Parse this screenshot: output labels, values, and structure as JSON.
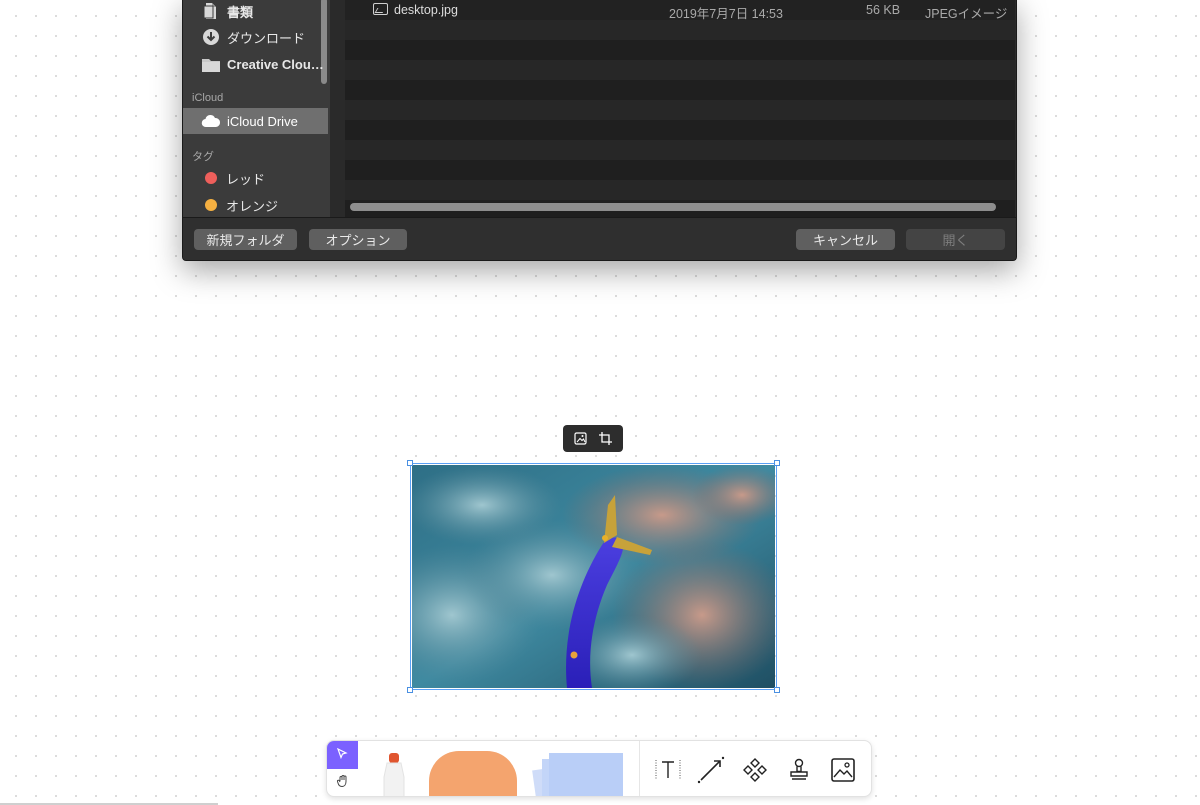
{
  "dialog": {
    "sidebar": {
      "favorites": [
        {
          "label": "書類",
          "icon": "document-icon"
        },
        {
          "label": "ダウンロード",
          "icon": "download-icon"
        },
        {
          "label": "Creative Clou…",
          "icon": "folder-icon"
        }
      ],
      "icloud_header": "iCloud",
      "icloud_items": [
        {
          "label": "iCloud Drive",
          "icon": "cloud-icon",
          "selected": true
        }
      ],
      "tags_header": "タグ",
      "tags": [
        {
          "label": "レッド",
          "color": "#ee5f5b"
        },
        {
          "label": "オレンジ",
          "color": "#f5b041"
        }
      ]
    },
    "files": [
      {
        "name": "desktop.jpg",
        "date": "2019年7月7日 14:53",
        "size": "56 KB",
        "kind": "JPEGイメージ"
      }
    ],
    "footer": {
      "new_folder": "新規フォルダ",
      "options": "オプション",
      "cancel": "キャンセル",
      "open": "開く"
    }
  },
  "canvas": {
    "image_toolbar": {
      "icons": [
        "image-icon",
        "crop-icon"
      ]
    },
    "selected_image": {
      "subject": "fish-photo",
      "selection_color": "#5aa0f5"
    }
  },
  "toolbar": {
    "accent": "#7b61ff",
    "tools": [
      "select",
      "hand",
      "marker",
      "shape",
      "sticky-note",
      "text",
      "connector",
      "component",
      "stamp",
      "image"
    ],
    "shape_color": "#f4a46e",
    "sticky_color": "#b9cef7",
    "marker_color": "#e0552f"
  }
}
